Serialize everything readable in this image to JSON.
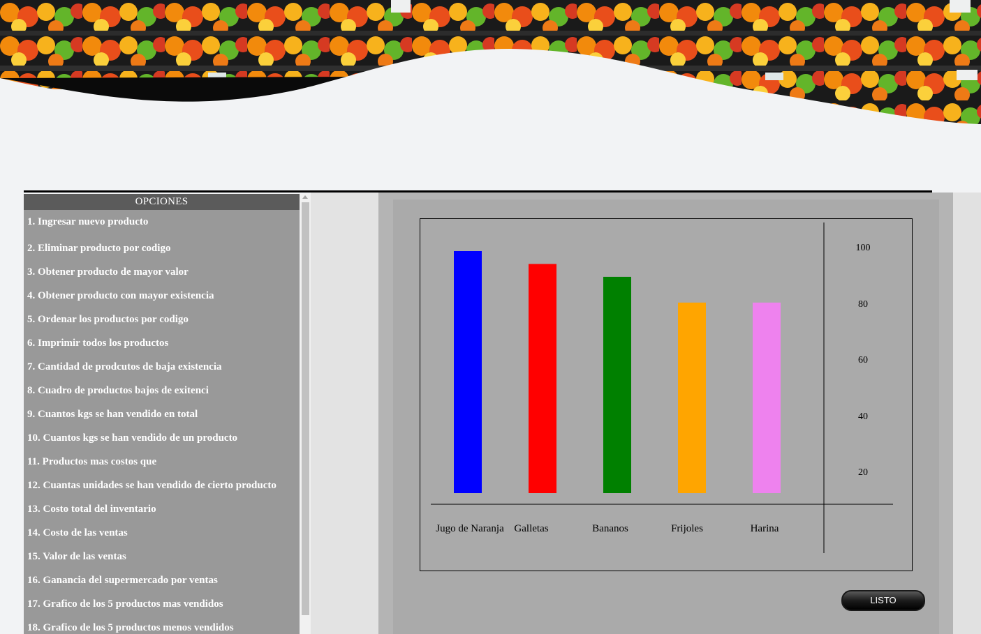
{
  "banner": {
    "image": "supermarket-fruit-shelves"
  },
  "sidebar": {
    "title": "OPCIONES",
    "items": [
      "1. Ingresar nuevo producto",
      "2. Eliminar producto por codigo",
      "3. Obtener producto de mayor valor",
      "4. Obtener producto con mayor existencia",
      "5. Ordenar los productos por codigo",
      "6. Imprimir todos los productos",
      "7. Cantidad de prodcutos de baja existencia",
      "8. Cuadro de productos bajos de exitenci",
      "9. Cuantos kgs se han vendido en total",
      "10. Cuantos kgs se han vendido de un producto",
      "11. Productos mas costos que",
      "12. Cuantas unidades se han vendido de cierto producto",
      "13. Costo total del inventario",
      "14. Costo de las ventas",
      "15. Valor de las ventas",
      "16. Ganancia del supermercado por ventas",
      "17. Grafico de los 5 productos mas vendidos",
      "18. Grafico de los 5 productos menos vendidos"
    ]
  },
  "chart_data": {
    "type": "bar",
    "categories": [
      "Jugo de Naranja",
      "Galletas",
      "Bananos",
      "Frijoles",
      "Harina"
    ],
    "values": [
      94,
      89,
      84,
      74,
      74
    ],
    "colors": [
      "#0000ff",
      "#ff0000",
      "#008000",
      "#ffa500",
      "#ee82ee"
    ],
    "y_ticks": [
      20,
      40,
      60,
      80,
      100
    ],
    "ylim": [
      0,
      100
    ],
    "y_axis_position": "right",
    "grid": false,
    "title": "",
    "xlabel": "",
    "ylabel": ""
  },
  "actions": {
    "listo_label": "LISTO"
  }
}
